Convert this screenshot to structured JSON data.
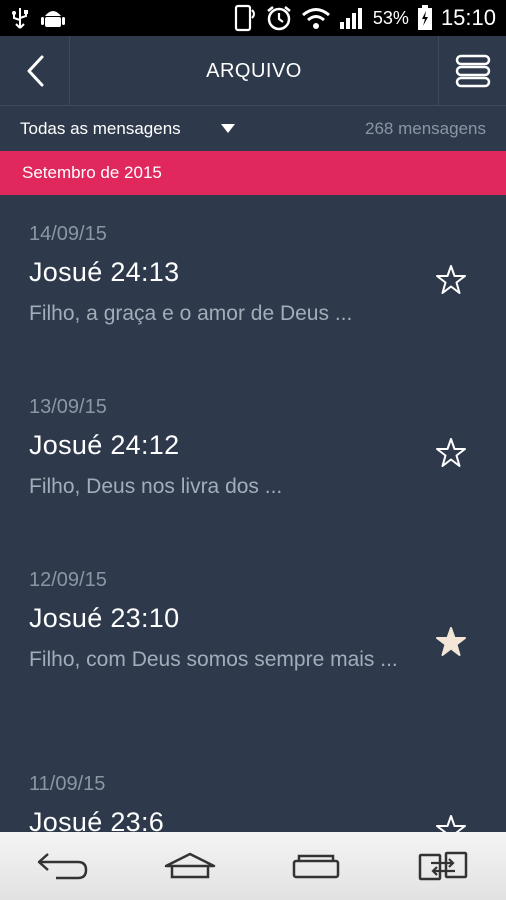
{
  "status_bar": {
    "battery": "53%",
    "time": "15:10",
    "icons": [
      "usb-icon",
      "android-debug-icon",
      "phone-rotate-icon",
      "alarm-icon",
      "wifi-icon",
      "signal-icon",
      "battery-icon"
    ]
  },
  "header": {
    "title": "ARQUIVO",
    "back_icon": "chevron-left-icon",
    "menu_icon": "menu-icon"
  },
  "filter": {
    "selected": "Todas as mensagens",
    "count": "268 mensagens"
  },
  "month": "Setembro de 2015",
  "messages": [
    {
      "date": "14/09/15",
      "ref": "Josué  24:13",
      "preview": "Filho,  a graça e o amor de Deus ...",
      "starred": false
    },
    {
      "date": "13/09/15",
      "ref": "Josué  24:12",
      "preview": "Filho, Deus nos livra dos  ...",
      "starred": false
    },
    {
      "date": "12/09/15",
      "ref": "Josué  23:10",
      "preview": "Filho, com Deus somos sempre mais ...",
      "starred": true
    },
    {
      "date": "11/09/15",
      "ref": "Josué  23:6",
      "preview": "",
      "starred": false
    }
  ],
  "colors": {
    "background": "#2e3a4c",
    "accent": "#e0285c",
    "muted_text": "#8b95a3",
    "star_filled": "#f3e6d6"
  },
  "nav_icons": [
    "back-icon",
    "home-icon",
    "recent-apps-icon",
    "switch-app-icon"
  ]
}
